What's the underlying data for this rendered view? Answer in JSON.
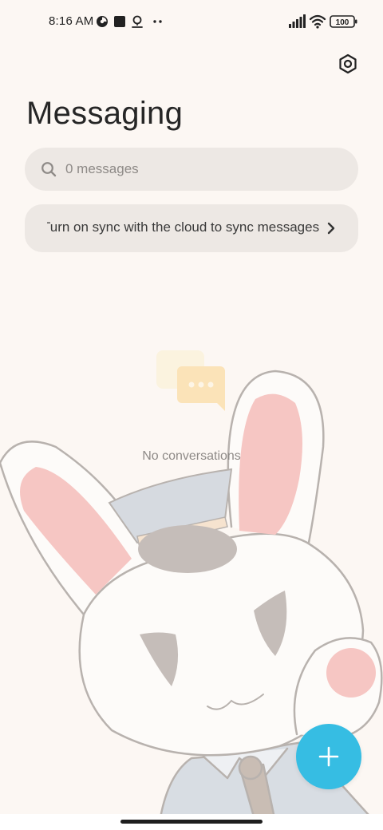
{
  "status_bar": {
    "time": "8:16 AM",
    "battery": "100",
    "left_icons": [
      "data-saver-icon",
      "square-notification-icon",
      "location-badge-icon",
      "more-dots-icon"
    ],
    "right_icons": [
      "signal-icon",
      "wifi-icon",
      "battery-icon"
    ]
  },
  "header": {
    "title": "Messaging",
    "settings_icon": "settings-hex-icon"
  },
  "search": {
    "placeholder": "0 messages",
    "icon": "search-icon"
  },
  "sync_banner": {
    "text": "Turn on sync with the cloud to sync messages",
    "chevron": "chevron-right-icon"
  },
  "empty_state": {
    "text": "No conversations",
    "icon": "chat-bubbles-icon"
  },
  "fab": {
    "icon": "plus-icon"
  },
  "colors": {
    "background": "#fcf7f3",
    "field": "#ede8e4",
    "accent": "#36bde3",
    "muted_text": "#8e8a87",
    "bunny_outline": "#b8b2ae",
    "bunny_pink": "#f6c6c3",
    "cap": "#d6dae0"
  }
}
